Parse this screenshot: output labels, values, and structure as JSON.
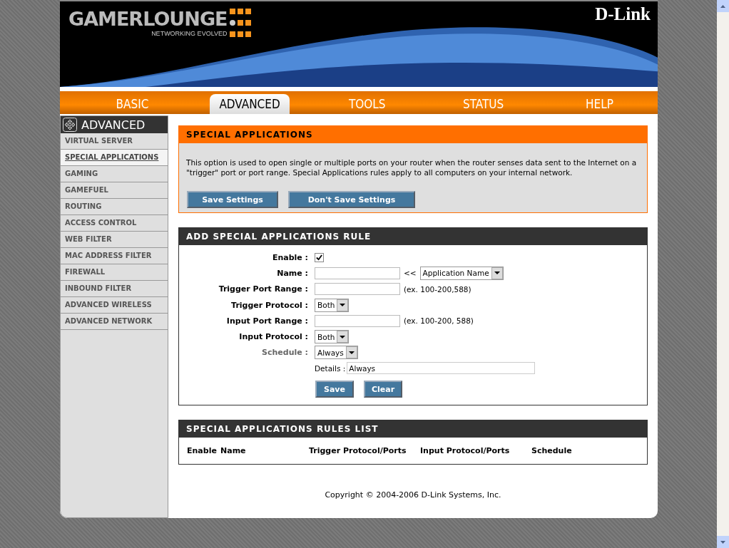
{
  "header": {
    "logo": "GAMERLOUNGE",
    "tagline": "NETWORKING EVOLVED",
    "brand": "D-Link"
  },
  "tabs": [
    {
      "label": "BASIC",
      "selected": false
    },
    {
      "label": "ADVANCED",
      "selected": true
    },
    {
      "label": "TOOLS",
      "selected": false
    },
    {
      "label": "STATUS",
      "selected": false
    },
    {
      "label": "HELP",
      "selected": false
    }
  ],
  "sidebar": {
    "title": "ADVANCED",
    "items": [
      {
        "label": "VIRTUAL SERVER",
        "selected": false
      },
      {
        "label": "SPECIAL APPLICATIONS",
        "selected": true
      },
      {
        "label": "GAMING",
        "selected": false
      },
      {
        "label": "GAMEFUEL",
        "selected": false
      },
      {
        "label": "ROUTING",
        "selected": false
      },
      {
        "label": "ACCESS CONTROL",
        "selected": false
      },
      {
        "label": "WEB FILTER",
        "selected": false
      },
      {
        "label": "MAC ADDRESS FILTER",
        "selected": false
      },
      {
        "label": "FIREWALL",
        "selected": false
      },
      {
        "label": "INBOUND FILTER",
        "selected": false
      },
      {
        "label": "ADVANCED WIRELESS",
        "selected": false
      },
      {
        "label": "ADVANCED NETWORK",
        "selected": false
      }
    ]
  },
  "intro": {
    "title": "SPECIAL APPLICATIONS",
    "text": "This option is used to open single or multiple ports on your router when the router senses data sent to the Internet on a \"trigger\" port or port range. Special Applications rules apply to all computers on your internal network.",
    "buttons": [
      "Save Settings",
      "Don't Save Settings"
    ]
  },
  "rule": {
    "title": "ADD SPECIAL APPLICATIONS RULE",
    "fields": [
      {
        "kind": "checkbox",
        "label": "Enable :",
        "muted": false,
        "checked": true
      },
      {
        "kind": "text-select",
        "label": "Name :",
        "muted": false,
        "hint": "<<",
        "select": "Application Name"
      },
      {
        "kind": "text",
        "label": "Trigger Port Range :",
        "muted": false,
        "hint": "(ex. 100-200,588)"
      },
      {
        "kind": "select",
        "label": "Trigger Protocol :",
        "muted": false,
        "select": "Both"
      },
      {
        "kind": "text",
        "label": "Input Port Range :",
        "muted": false,
        "hint": "(ex. 100-200, 588)"
      },
      {
        "kind": "select",
        "label": "Input Protocol :",
        "muted": false,
        "select": "Both"
      },
      {
        "kind": "select",
        "label": "Schedule :",
        "muted": true,
        "select": "Always"
      }
    ],
    "details": {
      "label": "Details :",
      "value": "Always"
    },
    "buttons": [
      "Save",
      "Clear"
    ]
  },
  "list": {
    "title": "SPECIAL APPLICATIONS RULES LIST",
    "columns": [
      "Enable",
      "Name",
      "Trigger Protocol/Ports",
      "Input Protocol/Ports",
      "Schedule"
    ]
  },
  "footer": "Copyright © 2004-2006 D-Link Systems, Inc."
}
